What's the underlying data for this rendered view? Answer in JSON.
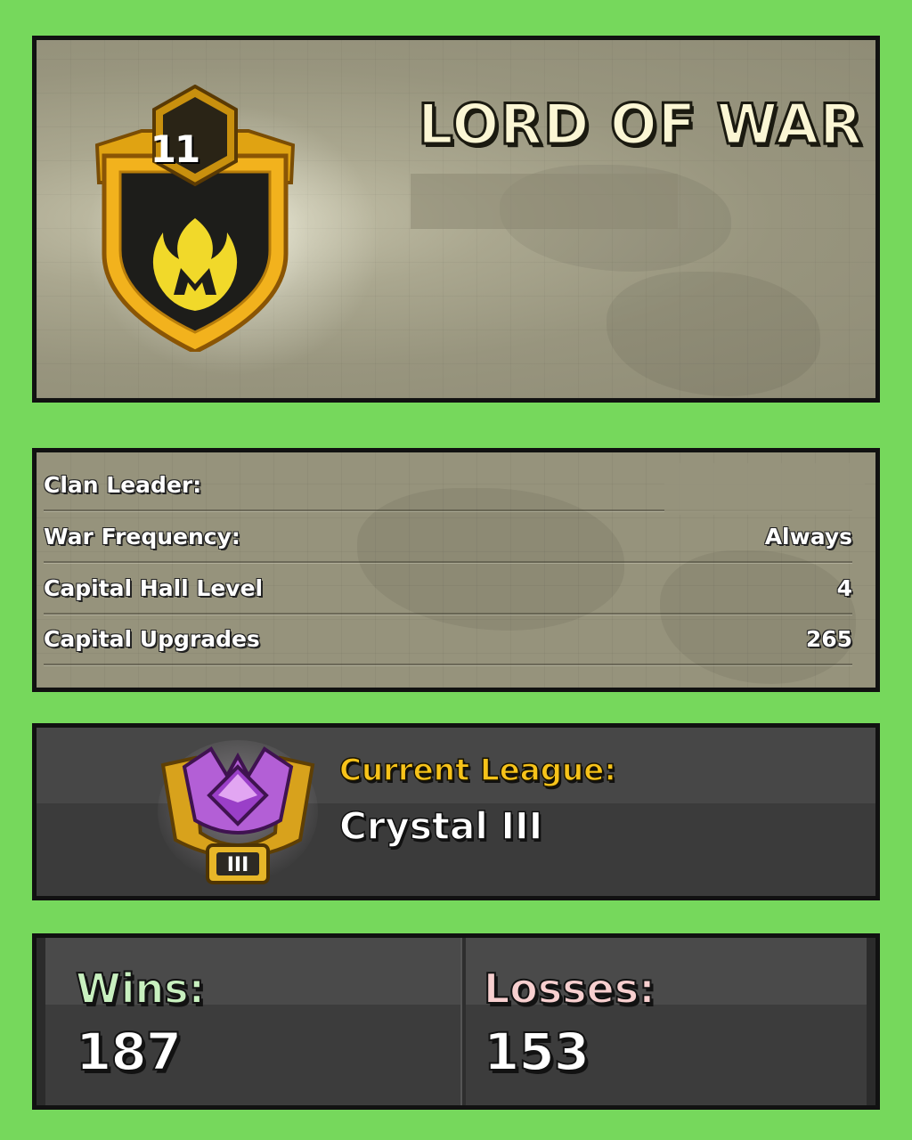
{
  "clan": {
    "name": "LORD OF WAR",
    "level": "11",
    "badge_icon": "flame-icon"
  },
  "info": {
    "rows": [
      {
        "label": "Clan Leader:",
        "value": ""
      },
      {
        "label": "War Frequency:",
        "value": "Always"
      },
      {
        "label": "Capital Hall Level",
        "value": "4"
      },
      {
        "label": "Capital Upgrades",
        "value": "265"
      }
    ]
  },
  "league": {
    "title": "Current League:",
    "name": "Crystal III",
    "icon": "crystal-league-icon",
    "tier": "III"
  },
  "stats": {
    "wins_label": "Wins:",
    "wins_value": "187",
    "losses_label": "Losses:",
    "losses_value": "153"
  },
  "colors": {
    "background": "#76d85c",
    "league_title": "#f7c31a",
    "wins_label": "#c8f0bf",
    "losses_label": "#f7cfcf"
  }
}
